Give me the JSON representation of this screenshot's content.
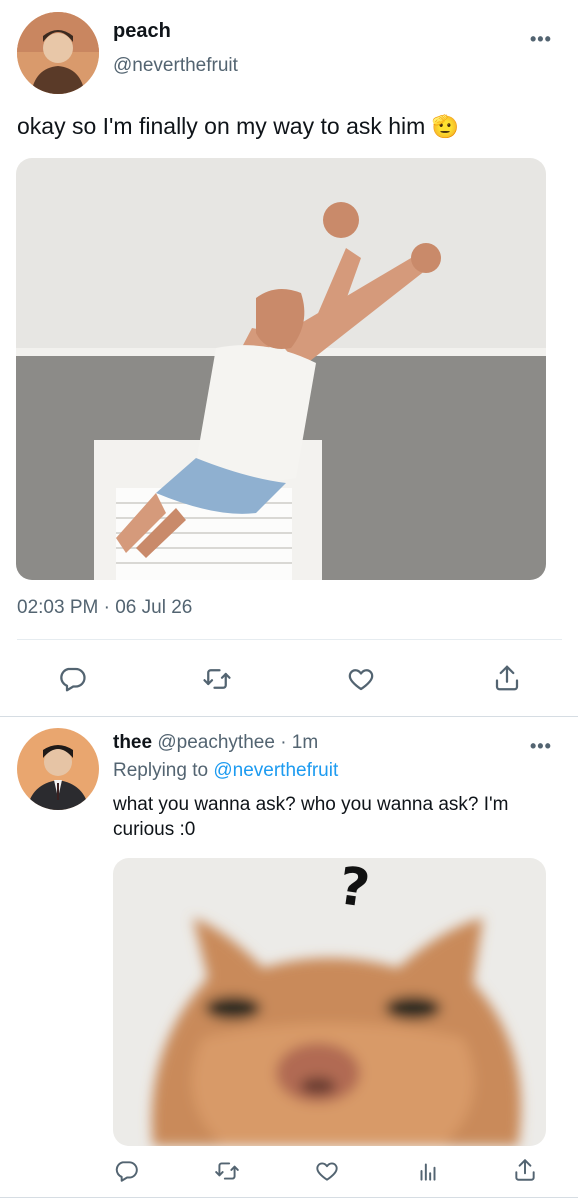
{
  "tweet": {
    "display_name": "peach",
    "handle": "@neverthefruit",
    "text": "okay so I'm finally on my way to ask him",
    "emoji": "🫡",
    "timestamp": "02:03 PM · 06 Jul 26",
    "media_icon": "jumping-boy-photo"
  },
  "reply": {
    "display_name": "thee",
    "handle": "@peachythee",
    "separator": "·",
    "time": "1m",
    "replying_prefix": "Replying to",
    "replying_to": "@neverthefruit",
    "text": "what you wanna ask? who you wanna ask? I'm curious :0",
    "question_mark": "?",
    "media_icon": "cat-photo"
  },
  "icons": {
    "more": "more-dots-icon",
    "reply": "reply-icon",
    "retweet": "retweet-icon",
    "like": "heart-icon",
    "share": "share-icon",
    "analytics": "analytics-icon"
  },
  "colors": {
    "link": "#1d9bf0",
    "muted": "#536471"
  }
}
